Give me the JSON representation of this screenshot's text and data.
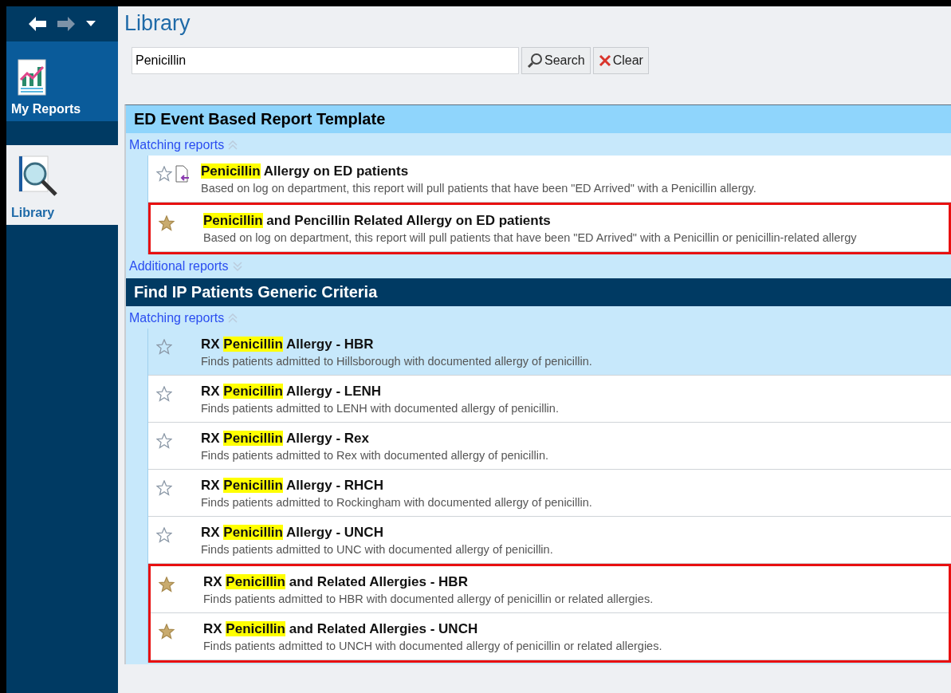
{
  "nav": {
    "items": [
      {
        "label": "My Reports",
        "selected": false
      },
      {
        "label": "Library",
        "selected": true
      }
    ]
  },
  "page": {
    "title": "Library"
  },
  "search": {
    "value": "Penicillin",
    "search_button": "Search",
    "clear_button": "Clear"
  },
  "sections": [
    {
      "title": "ED Event Based Report Template",
      "kind": "light",
      "matching": {
        "label": "Matching reports",
        "expanded": true
      },
      "additional": {
        "label": "Additional reports",
        "expanded": false
      },
      "blocks": [
        {
          "outlined": false,
          "reports": [
            {
              "highlight": "Penicillin",
              "after": " Allergy on ED patients",
              "description": "Based on log on department, this report will pull patients that have been \"ED Arrived\" with a Penicillin allergy.",
              "favorite": false,
              "doc_icon": true,
              "selected": false
            }
          ]
        },
        {
          "outlined": true,
          "reports": [
            {
              "highlight": "Penicillin",
              "after": " and Pencillin Related Allergy on ED patients",
              "description": "Based on log on department, this report will pull patients that have been \"ED Arrived\" with a Penicillin or penicillin-related allergy",
              "favorite": true,
              "doc_icon": false,
              "selected": false
            }
          ]
        }
      ]
    },
    {
      "title": "Find IP Patients Generic Criteria",
      "kind": "dark",
      "matching": {
        "label": "Matching reports",
        "expanded": true
      },
      "blocks": [
        {
          "outlined": false,
          "reports": [
            {
              "before": "RX ",
              "highlight": "Penicillin",
              "after": " Allergy - HBR",
              "description": "Finds patients admitted to Hillsborough with documented allergy of penicillin.",
              "favorite": false,
              "doc_icon": false,
              "selected": true
            },
            {
              "before": "RX ",
              "highlight": "Penicillin",
              "after": " Allergy - LENH",
              "description": "Finds patients admitted to LENH with documented allergy of penicillin.",
              "favorite": false,
              "doc_icon": false,
              "selected": false
            },
            {
              "before": "RX ",
              "highlight": "Penicillin",
              "after": " Allergy - Rex",
              "description": "Finds patients admitted to Rex with documented allergy of penicillin.",
              "favorite": false,
              "doc_icon": false,
              "selected": false
            },
            {
              "before": "RX ",
              "highlight": "Penicillin",
              "after": " Allergy - RHCH",
              "description": "Finds patients admitted to Rockingham with documented allergy of penicillin.",
              "favorite": false,
              "doc_icon": false,
              "selected": false
            },
            {
              "before": "RX ",
              "highlight": "Penicillin",
              "after": " Allergy - UNCH",
              "description": "Finds patients admitted to UNC with documented allergy of penicillin.",
              "favorite": false,
              "doc_icon": false,
              "selected": false
            }
          ]
        },
        {
          "outlined": true,
          "reports": [
            {
              "before": "RX ",
              "highlight": "Penicillin",
              "after": " and Related Allergies - HBR",
              "description": "Finds patients admitted to HBR with documented allergy of penicillin or related allergies.",
              "favorite": true,
              "doc_icon": false,
              "selected": false
            },
            {
              "before": "RX ",
              "highlight": "Penicillin",
              "after": " and Related Allergies - UNCH",
              "description": "Finds patients admitted to UNCH with documented allergy of penicillin or related allergies.",
              "favorite": true,
              "doc_icon": false,
              "selected": false
            }
          ]
        }
      ]
    }
  ]
}
